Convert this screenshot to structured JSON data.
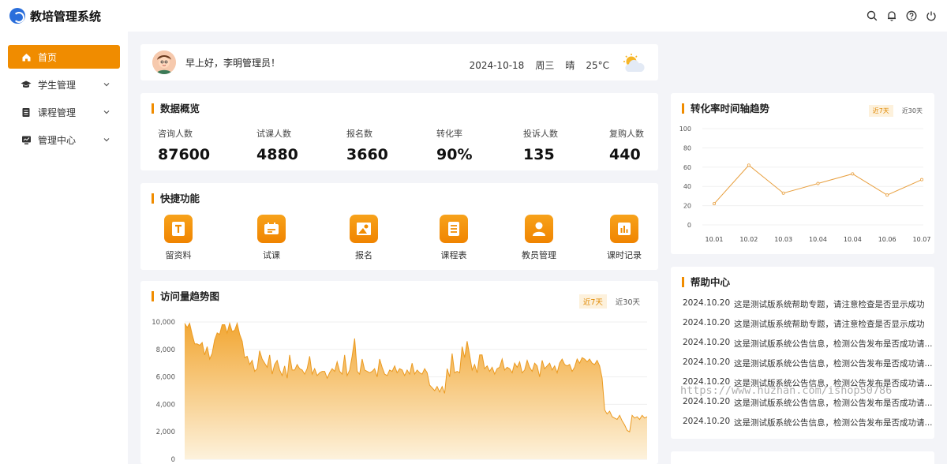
{
  "header": {
    "title": "教培管理系统",
    "icons": [
      "search-icon",
      "bell-icon",
      "help-icon",
      "power-icon"
    ]
  },
  "sidebar": {
    "items": [
      {
        "label": "首页",
        "icon": "home-icon",
        "active": true
      },
      {
        "label": "学生管理",
        "icon": "graduation-cap-icon"
      },
      {
        "label": "课程管理",
        "icon": "book-icon"
      },
      {
        "label": "管理中心",
        "icon": "monitor-icon"
      }
    ]
  },
  "greeting": {
    "text": "早上好，李明管理员！",
    "date": "2024-10-18",
    "weekday": "周三",
    "weather": "晴",
    "temperature": "25°C"
  },
  "overview": {
    "title": "数据概览",
    "stats": [
      {
        "label": "咨询人数",
        "value": "87600"
      },
      {
        "label": "试课人数",
        "value": "4880"
      },
      {
        "label": "报名数",
        "value": "3660"
      },
      {
        "label": "转化率",
        "value": "90%"
      },
      {
        "label": "投诉人数",
        "value": "135"
      },
      {
        "label": "复购人数",
        "value": "440"
      }
    ]
  },
  "quick": {
    "title": "快捷功能",
    "items": [
      {
        "label": "留资料",
        "icon": "text-doc-icon"
      },
      {
        "label": "试课",
        "icon": "card-icon"
      },
      {
        "label": "报名",
        "icon": "image-upload-icon"
      },
      {
        "label": "课程表",
        "icon": "list-icon"
      },
      {
        "label": "教员管理",
        "icon": "user-icon"
      },
      {
        "label": "课时记录",
        "icon": "bar-chart-icon"
      }
    ]
  },
  "visit_chart": {
    "title": "访问量趋势图",
    "tab_active": "近7天",
    "tab_other": "近30天",
    "y_ticks": [
      "10,000",
      "8,000",
      "6,000",
      "4,000",
      "2,000",
      "0"
    ]
  },
  "conversion_chart": {
    "title": "转化率时间轴趋势",
    "tab_active": "近7天",
    "tab_other": "近30天"
  },
  "help": {
    "title": "帮助中心",
    "rows": [
      {
        "date": "2024.10.20",
        "text": "这是测试版系统帮助专题，请注意检查是否显示成功"
      },
      {
        "date": "2024.10.20",
        "text": "这是测试版系统帮助专题，请注意检查是否显示成功"
      },
      {
        "date": "2024.10.20",
        "text": "这是测试版系统公告信息，检测公告发布是否成功请..."
      },
      {
        "date": "2024.10.20",
        "text": "这是测试版系统公告信息，检测公告发布是否成功请..."
      },
      {
        "date": "2024.10.20",
        "text": "这是测试版系统公告信息，检测公告发布是否成功请..."
      },
      {
        "date": "2024.10.20",
        "text": "这是测试版系统公告信息，检测公告发布是否成功请..."
      },
      {
        "date": "2024.10.20",
        "text": "这是测试版系统公告信息，检测公告发布是否成功请..."
      }
    ]
  },
  "watermark": "https://www.huzhan.com/ishop50786",
  "colors": {
    "accent": "#f08c00",
    "accent_light": "#fdf1dc",
    "line": "#e8a040"
  },
  "chart_data": [
    {
      "type": "line",
      "title": "转化率时间轴趋势",
      "categories": [
        "10.01",
        "10.02",
        "10.03",
        "10.04",
        "10.04",
        "10.06",
        "10.07"
      ],
      "values": [
        22,
        62,
        33,
        43,
        53,
        31,
        47
      ],
      "ylim": [
        0,
        100
      ],
      "y_ticks": [
        0,
        20,
        40,
        60,
        80,
        100
      ],
      "grid": true
    },
    {
      "type": "area",
      "title": "访问量趋势图",
      "ylim": [
        0,
        10000
      ],
      "y_ticks": [
        0,
        2000,
        4000,
        6000,
        8000,
        10000
      ],
      "values": [
        9900,
        9600,
        9900,
        9100,
        8400,
        8400,
        8300,
        8500,
        7600,
        8200,
        7300,
        7700,
        8700,
        9200,
        9100,
        9800,
        9800,
        9200,
        9900,
        9300,
        9400,
        9900,
        9100,
        8600,
        7400,
        7500,
        6900,
        7200,
        6400,
        6600,
        7900,
        7300,
        7000,
        6700,
        7600,
        6200,
        6900,
        7200,
        6500,
        6100,
        6800,
        5900,
        7600,
        6500,
        6500,
        6900,
        6600,
        6500,
        6200,
        6600,
        7500,
        6200,
        6600,
        6100,
        6300,
        6400,
        6400,
        5900,
        6300,
        6600,
        6400,
        7100,
        6400,
        6200,
        7600,
        6100,
        6500,
        7500,
        8800,
        6400,
        6200,
        7300,
        6500,
        6400,
        6300,
        6400,
        6600,
        6000,
        7300,
        6700,
        6200,
        6100,
        6500,
        6400,
        6800,
        6300,
        6600,
        6500,
        6100,
        6500,
        6200,
        7000,
        6200,
        6500,
        6300,
        6200,
        6600,
        6300,
        5400,
        5200,
        5000,
        5300,
        4900,
        5300,
        4800,
        6600,
        6000,
        7700,
        6300,
        6400,
        6300,
        8200,
        7400,
        8600,
        7600,
        6500,
        6900,
        6300,
        7600,
        7600,
        6600,
        6800,
        6400,
        6700,
        6200,
        6600,
        6700,
        7300,
        6500,
        6700,
        6600,
        6300,
        7000,
        6700,
        7100,
        6300,
        6500,
        7200,
        6700,
        6400,
        7000,
        6800,
        6000,
        7200,
        6600,
        6800,
        7000,
        6500,
        6800,
        6300,
        7000,
        7300,
        6900,
        6800,
        6900,
        6400,
        6700,
        7300,
        7000,
        7400,
        7300,
        7100,
        7300,
        7000,
        6900,
        7200,
        6800,
        5900,
        3600,
        3300,
        3500,
        3100,
        3000,
        2900,
        3200,
        2800,
        2500,
        2100,
        2000,
        3200,
        3000,
        3100,
        2900,
        3200,
        3000,
        3100
      ]
    }
  ]
}
